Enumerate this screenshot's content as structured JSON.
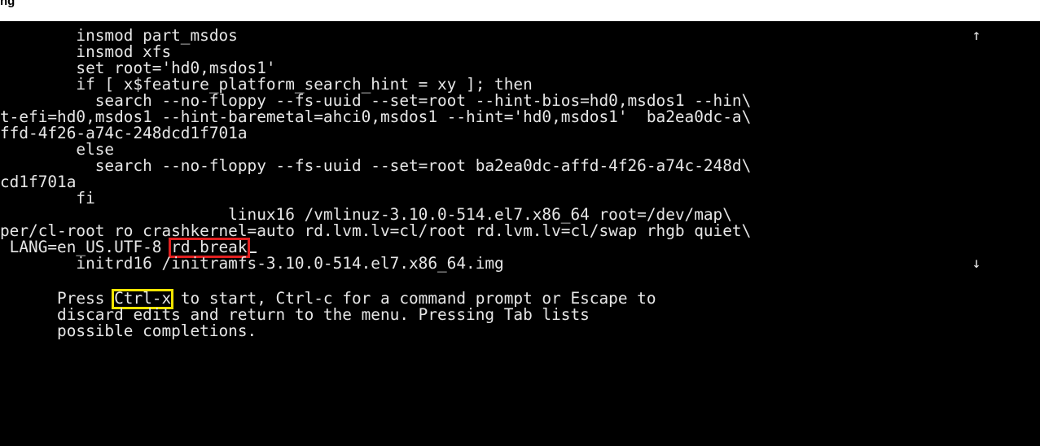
{
  "heading": "ng",
  "editor": {
    "lines": [
      "        insmod part_msdos",
      "        insmod xfs",
      "        set root='hd0,msdos1'",
      "        if [ x$feature_platform_search_hint = xy ]; then",
      "          search --no-floppy --fs-uuid --set=root --hint-bios=hd0,msdos1 --hin\\",
      "t-efi=hd0,msdos1 --hint-baremetal=ahci0,msdos1 --hint='hd0,msdos1'  ba2ea0dc-a\\",
      "ffd-4f26-a74c-248dcd1f701a",
      "        else",
      "          search --no-floppy --fs-uuid --set=root ba2ea0dc-affd-4f26-a74c-248d\\",
      "cd1f701a",
      "        fi",
      "                        linux16 /vmlinuz-3.10.0-514.el7.x86_64 root=/dev/map\\",
      "per/cl-root ro crashkernel=auto rd.lvm.lv=cl/root rd.lvm.lv=cl/swap rhgb quiet\\"
    ],
    "lang_line_prefix": " LANG=en_US.UTF-8 ",
    "rd_break": "rd.break",
    "initrd_line": "        initrd16 /initramfs-3.10.0-514.el7.x86_64.img"
  },
  "scroll": {
    "up_icon": "↑",
    "down_icon": "↓"
  },
  "help": {
    "line1_prefix": "      Press ",
    "ctrl_x": "Ctrl-x",
    "line1_suffix": " to start, Ctrl-c for a command prompt or Escape to",
    "line2": "      discard edits and return to the menu. Pressing Tab lists",
    "line3": "      possible completions."
  },
  "highlight_colors": {
    "rd_break_box": "#e02020",
    "ctrl_x_box": "#f2e400"
  }
}
